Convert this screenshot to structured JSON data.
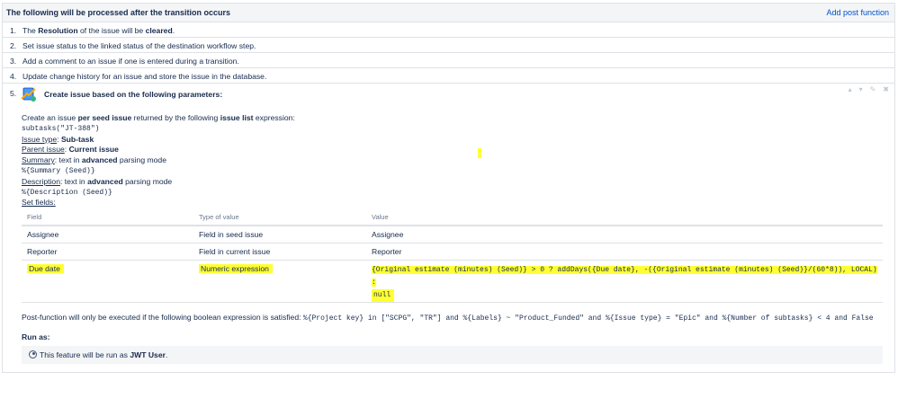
{
  "header": {
    "title": "The following will be processed after the transition occurs",
    "add_link": "Add post function"
  },
  "steps": [
    {
      "num": "1.",
      "pre": "The ",
      "b1": "Resolution",
      "mid": " of the issue will be ",
      "b2": "cleared",
      "post": "."
    },
    {
      "num": "2.",
      "text": "Set issue status to the linked status of the destination workflow step."
    },
    {
      "num": "3.",
      "text": "Add a comment to an issue if one is entered during a transition."
    },
    {
      "num": "4.",
      "text": "Update change history for an issue and store the issue in the database."
    }
  ],
  "step5": {
    "num": "5.",
    "title": "Create issue based on the following parameters:",
    "tools": [
      "▴",
      "▾",
      "✎",
      "✖"
    ],
    "create_line": {
      "pre": "Create an issue ",
      "b1": "per seed issue",
      "mid": " returned by the following ",
      "b2": "issue list",
      "post": " expression:"
    },
    "list_expr": "subtasks(\"JT-388\")",
    "issue_type": {
      "label": "Issue type",
      "value": "Sub-task"
    },
    "parent_issue": {
      "label": "Parent issue",
      "value": "Current issue"
    },
    "summary": {
      "label": "Summary",
      "pre": " text in ",
      "mode": "advanced",
      "post": " parsing mode",
      "expr": "%{Summary (Seed)}"
    },
    "description": {
      "label": "Description",
      "pre": " text in ",
      "mode": "advanced",
      "post": " parsing mode",
      "expr": "%{Description (Seed)}"
    },
    "set_fields": "Set fields:",
    "table": {
      "headers": [
        "Field",
        "Type of value",
        "Value"
      ],
      "rows": [
        {
          "field": "Assignee",
          "type": "Field in seed issue",
          "value": "Assignee"
        },
        {
          "field": "Reporter",
          "type": "Field in current issue",
          "value": "Reporter"
        },
        {
          "field": "Due date",
          "type": "Numeric expression",
          "value_line1": "{Original estimate (minutes) (Seed)} > 0 ? addDays({Due date}, -({Original estimate (minutes) (Seed)}/(60*8)), LOCAL) :",
          "value_line2": "null"
        }
      ]
    },
    "post_condition": {
      "pre": "Post-function will only be executed if the following boolean expression is satisfied: ",
      "expr": "%{Project key} in [\"SCPG\", \"TR\"] and %{Labels} ~ \"Product_Funded\" and %{Issue type} = \"Epic\" and %{Number of subtasks} < 4 and False"
    },
    "run_as": {
      "label": "Run as:",
      "pre": "This feature will be run as ",
      "user": "JWT User",
      "post": "."
    }
  },
  "colors": {
    "highlight": "#ffff33",
    "link": "#0052cc"
  }
}
